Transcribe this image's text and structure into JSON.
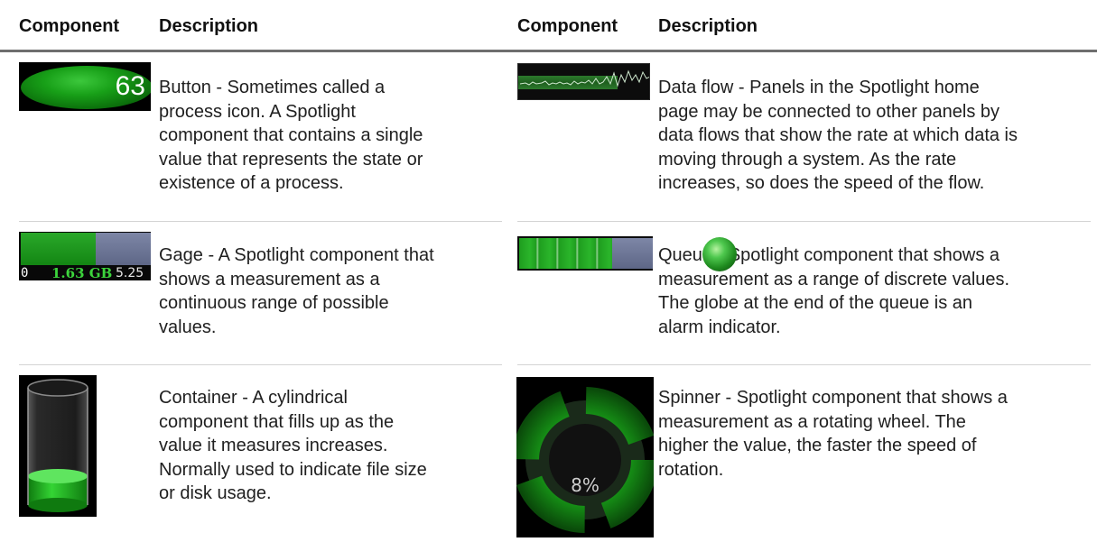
{
  "header": {
    "left_component": "Component",
    "left_description": "Description",
    "right_component": "Component",
    "right_description": "Description"
  },
  "rows": [
    {
      "left": {
        "value": "63",
        "lines": [
          "Button - Sometimes called a",
          "process icon. A Spotlight",
          "component that contains a single",
          "value that represents the state or",
          "existence of a process."
        ]
      },
      "right": {
        "lines": [
          "Data flow - Panels in the Spotlight home",
          "page may be connected to other panels by",
          "data flows that show the rate at which data is",
          "moving through a system. As the rate",
          "increases, so does the speed of the flow."
        ]
      }
    },
    {
      "left": {
        "min": "0",
        "current": "1.63 GB",
        "max": "5.25 GB",
        "lines": [
          "Gage - A Spotlight component that",
          "shows a measurement as a",
          "continuous range of possible",
          "values."
        ]
      },
      "right": {
        "lines": [
          "Queue - Spotlight component that shows a",
          "measurement as a range of discrete values.",
          "The globe at the end of the queue is an",
          "alarm indicator."
        ]
      }
    },
    {
      "left": {
        "lines": [
          "Container - A cylindrical",
          "component that fills up as the",
          "value it measures increases.",
          "Normally used to indicate file size",
          "or disk usage."
        ]
      },
      "right": {
        "value": "8%",
        "lines": [
          "Spinner - Spotlight component that shows a",
          "measurement as a rotating wheel. The",
          "higher the value, the faster the speed of",
          "rotation."
        ]
      }
    }
  ],
  "colors": {
    "component_green": "#18a018",
    "gage_empty": "#6f78a0",
    "rule": "#6e6e6e"
  }
}
